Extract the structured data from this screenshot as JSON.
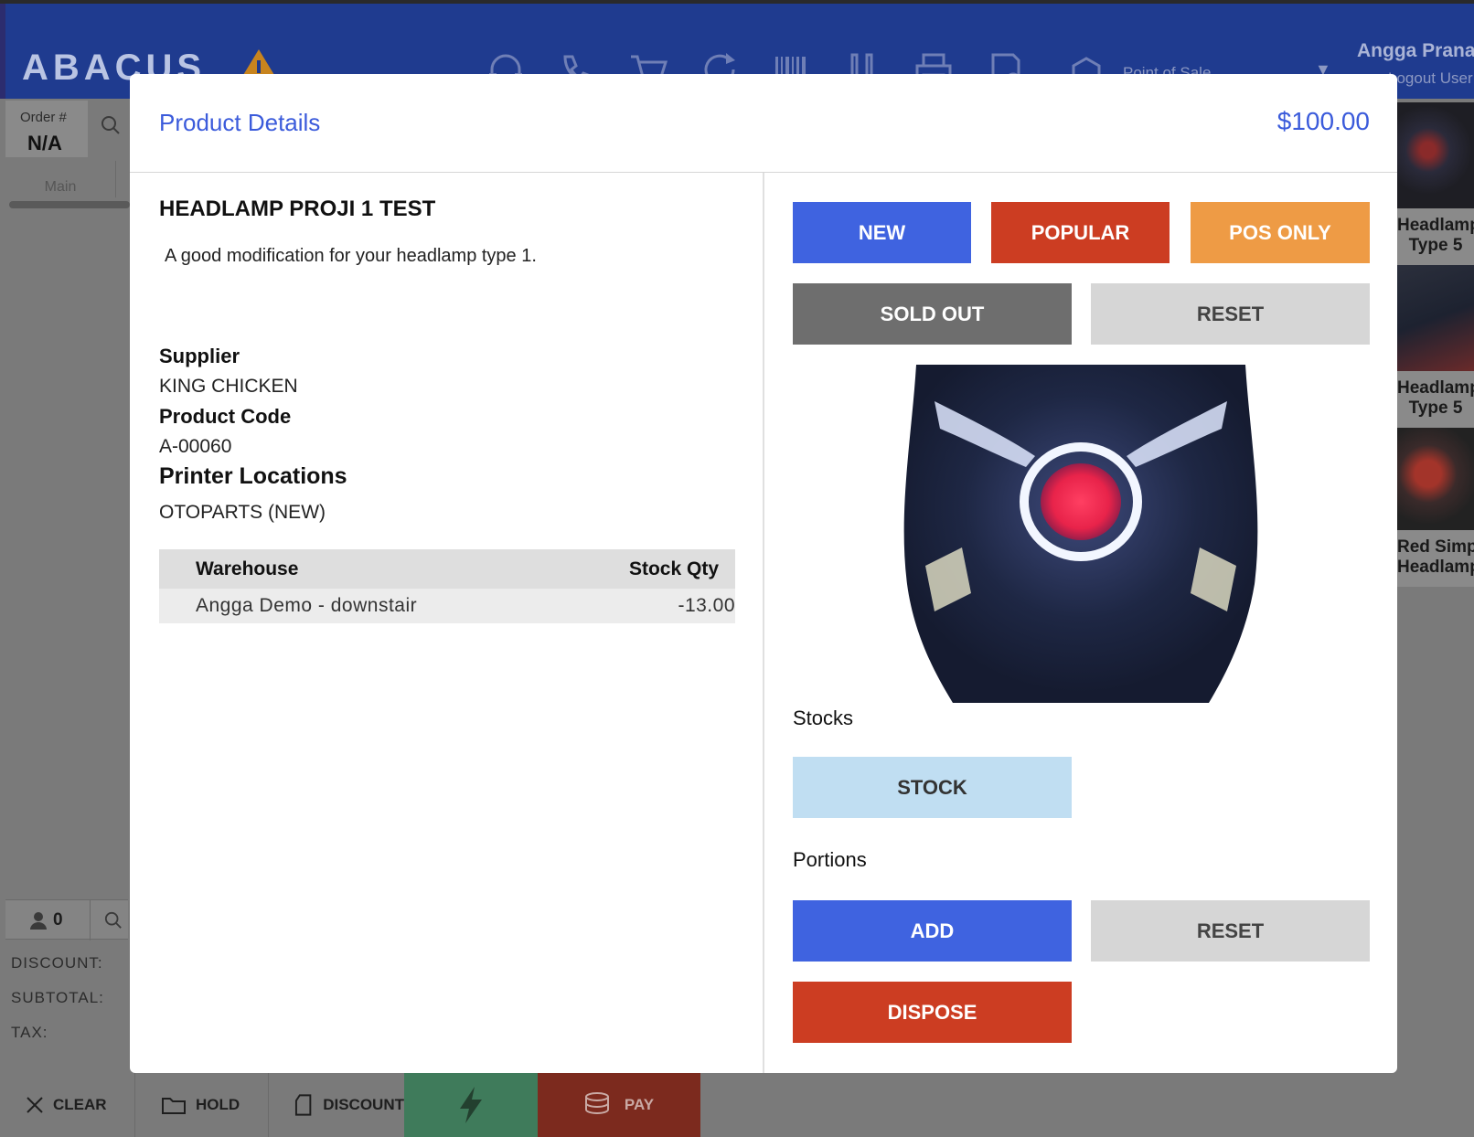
{
  "app": {
    "logo": "ABACUS",
    "mode_label": "Point of Sale",
    "user_name": "Angga Prana",
    "logout_label": "Logout User",
    "order_label": "Order #",
    "order_value": "N/A",
    "tab_main": "Main",
    "customer_count": "0",
    "totals": {
      "discount": "DISCOUNT:",
      "subtotal": "SUBTOTAL:",
      "tax": "TAX:"
    },
    "bottom": {
      "clear": "CLEAR",
      "hold": "HOLD",
      "discount": "DISCOUNT",
      "pay": "PAY"
    },
    "side_products": [
      {
        "name_line1": "Headlamp P",
        "name_line2": "Type 5"
      },
      {
        "name_line1": "Headlamp V",
        "name_line2": "Type 5"
      },
      {
        "name_line1": "Red Simpl",
        "name_line2": "Headlamp"
      }
    ]
  },
  "modal": {
    "title": "Product Details",
    "price": "$100.00",
    "product_name": "HEADLAMP PROJI 1 TEST",
    "description": "A good modification for your headlamp type 1.",
    "supplier_label": "Supplier",
    "supplier_value": "KING CHICKEN",
    "code_label": "Product Code",
    "code_value": "A-00060",
    "printer_label": "Printer Locations",
    "printer_value": "OTOPARTS (NEW)",
    "stock_table": {
      "headers": [
        "Warehouse",
        "Stock Qty"
      ],
      "rows": [
        [
          "Angga Demo - downstair",
          "-13.00"
        ]
      ]
    },
    "tag_buttons": {
      "new": "NEW",
      "popular": "POPULAR",
      "pos_only": "POS ONLY",
      "sold_out": "SOLD OUT",
      "reset": "RESET"
    },
    "stocks_label": "Stocks",
    "stock_button": "STOCK",
    "portions_label": "Portions",
    "portion_buttons": {
      "add": "ADD",
      "reset": "RESET",
      "dispose": "DISPOSE"
    }
  },
  "colors": {
    "accent_blue": "#3f63e0",
    "danger_red": "#cc3d22",
    "orange": "#ee9b45",
    "header_blue": "#1f3b8f"
  }
}
